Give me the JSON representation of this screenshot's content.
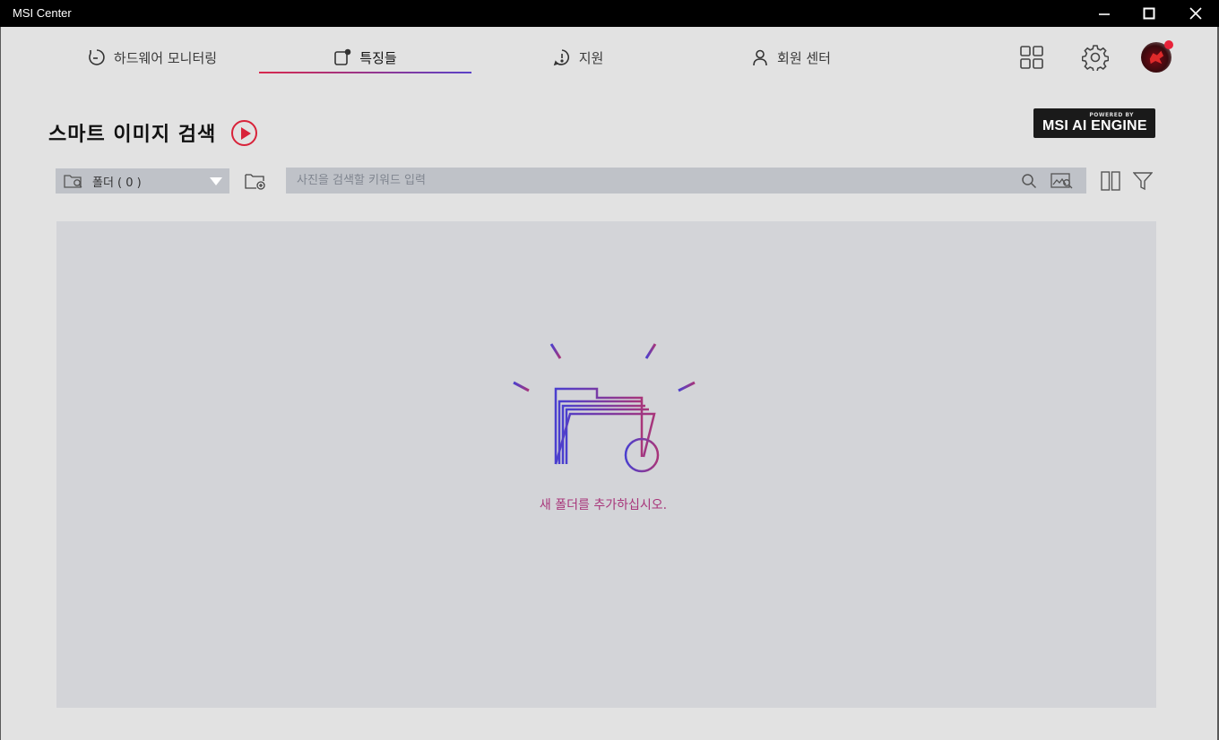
{
  "app": {
    "title": "MSI Center",
    "colors": {
      "titlebar": "#000000",
      "accent_red": "#d8233a",
      "accent_purple": "#5a42c8",
      "message_magenta": "#a8357a"
    }
  },
  "window_controls": {
    "minimize_icon": "minimize-icon",
    "maximize_icon": "maximize-icon",
    "close_icon": "close-icon"
  },
  "nav": {
    "tabs": [
      {
        "label": "하드웨어 모니터링",
        "icon": "gauge-icon",
        "active": false
      },
      {
        "label": "특징들",
        "icon": "feature-icon",
        "active": true
      },
      {
        "label": "지원",
        "icon": "alert-circle-icon",
        "active": false
      },
      {
        "label": "회원 센터",
        "icon": "user-icon",
        "active": false
      }
    ],
    "right_icons": [
      "grid-icon",
      "gear-icon",
      "avatar"
    ]
  },
  "page": {
    "title": "스마트 이미지 검색",
    "play_icon": "play-icon",
    "badge": {
      "small": "POWERED BY",
      "big": "MSI AI ENGINE"
    }
  },
  "toolbar": {
    "folder_select_label": "폴더 ( 0 )",
    "search_placeholder": "사진을 검색할 키워드 입력",
    "search_value": ""
  },
  "empty_state": {
    "message": "새 폴더를 추가하십시오.",
    "icon": "add-folder-illustration-icon"
  }
}
